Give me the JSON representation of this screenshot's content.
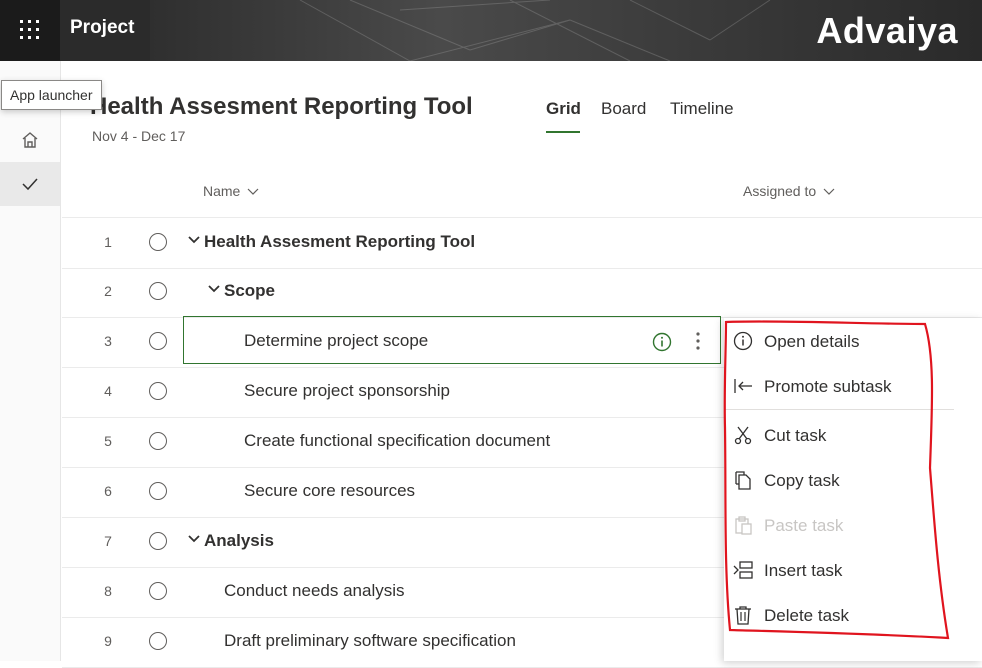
{
  "topbar": {
    "app_launcher_tooltip": "App launcher",
    "app_name": "Project",
    "brand": "Advaiya"
  },
  "project": {
    "title": "Health Assesment Reporting Tool",
    "dates": "Nov 4 - Dec 17"
  },
  "tabs": [
    {
      "label": "Grid",
      "active": true
    },
    {
      "label": "Board",
      "active": false
    },
    {
      "label": "Timeline",
      "active": false
    }
  ],
  "columns": {
    "name": "Name",
    "assigned_to": "Assigned to"
  },
  "rows": [
    {
      "num": "1",
      "name": "Health Assesment Reporting Tool",
      "bold": true,
      "expandable": true
    },
    {
      "num": "2",
      "name": "Scope",
      "bold": true,
      "expandable": true
    },
    {
      "num": "3",
      "name": "Determine project scope",
      "bold": false,
      "selected": true
    },
    {
      "num": "4",
      "name": "Secure project sponsorship",
      "bold": false
    },
    {
      "num": "5",
      "name": "Create functional specification document",
      "bold": false
    },
    {
      "num": "6",
      "name": "Secure core resources",
      "bold": false
    },
    {
      "num": "7",
      "name": "Analysis",
      "bold": true,
      "expandable": true
    },
    {
      "num": "8",
      "name": "Conduct needs analysis",
      "bold": false
    },
    {
      "num": "9",
      "name": "Draft preliminary software specification",
      "bold": false
    }
  ],
  "context_menu": {
    "items": [
      {
        "label": "Open details",
        "icon": "info-icon",
        "disabled": false
      },
      {
        "label": "Promote subtask",
        "icon": "promote-icon",
        "disabled": false
      },
      {
        "label": "Cut task",
        "icon": "scissors-icon",
        "disabled": false
      },
      {
        "label": "Copy task",
        "icon": "copy-icon",
        "disabled": false
      },
      {
        "label": "Paste task",
        "icon": "paste-icon",
        "disabled": true
      },
      {
        "label": "Insert task",
        "icon": "insert-icon",
        "disabled": false
      },
      {
        "label": "Delete task",
        "icon": "trash-icon",
        "disabled": false
      }
    ]
  },
  "colors": {
    "accent": "#31752f",
    "topbar": "#2b2b2b",
    "annotation": "#e0141e"
  }
}
